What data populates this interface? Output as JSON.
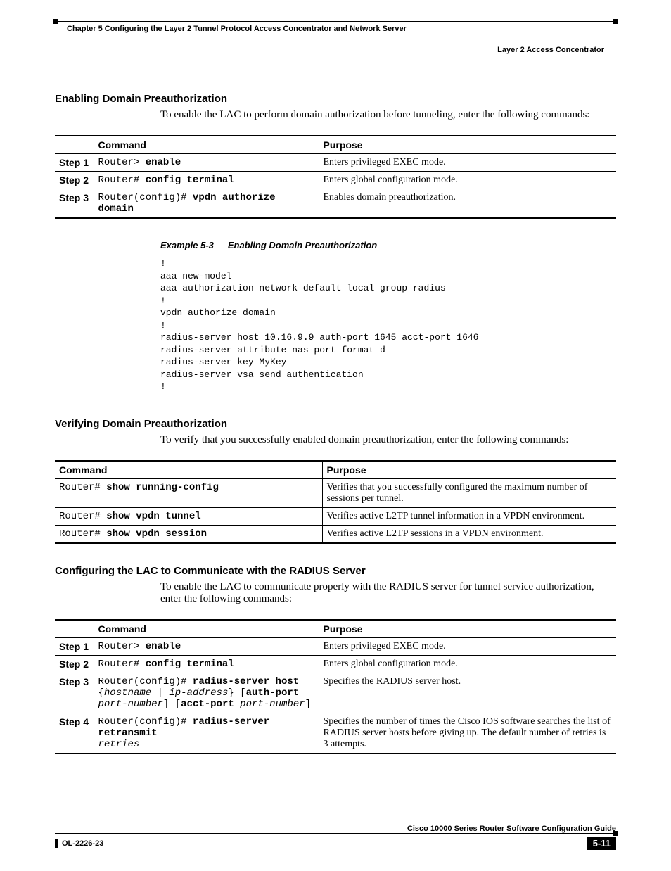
{
  "header": {
    "chapter": "Chapter 5    Configuring the Layer 2 Tunnel Protocol Access Concentrator and Network Server",
    "section": "Layer 2 Access Concentrator"
  },
  "s1": {
    "title": "Enabling Domain Preauthorization",
    "intro": "To enable the LAC to perform domain authorization before tunneling, enter the following commands:",
    "th_cmd": "Command",
    "th_purpose": "Purpose",
    "rows": [
      {
        "step": "Step 1",
        "prompt": "Router> ",
        "cmd": "enable",
        "purpose": "Enters privileged EXEC mode."
      },
      {
        "step": "Step 2",
        "prompt": "Router# ",
        "cmd": "config terminal",
        "purpose": "Enters global configuration mode."
      },
      {
        "step": "Step 3",
        "prompt": "Router(config)# ",
        "cmd": "vpdn authorize domain",
        "purpose": "Enables domain preauthorization."
      }
    ],
    "example_label": "Example 5-3",
    "example_title": "Enabling Domain Preauthorization",
    "code": "!\naaa new-model\naaa authorization network default local group radius\n!\nvpdn authorize domain\n!\nradius-server host 10.16.9.9 auth-port 1645 acct-port 1646\nradius-server attribute nas-port format d\nradius-server key MyKey\nradius-server vsa send authentication\n!"
  },
  "s2": {
    "title": "Verifying Domain Preauthorization",
    "intro": "To verify that you successfully enabled domain preauthorization, enter the following commands:",
    "th_cmd": "Command",
    "th_purpose": "Purpose",
    "rows": [
      {
        "prompt": "Router# ",
        "cmd": "show running-config",
        "purpose": "Verifies that you successfully configured the maximum number of sessions per tunnel."
      },
      {
        "prompt": "Router# ",
        "cmd": "show vpdn tunnel",
        "purpose": "Verifies active L2TP tunnel information in a VPDN environment."
      },
      {
        "prompt": "Router# ",
        "cmd": "show vpdn session",
        "purpose": "Verifies active L2TP sessions in a VPDN environment."
      }
    ]
  },
  "s3": {
    "title": "Configuring the LAC to Communicate with the RADIUS Server",
    "intro": "To enable the LAC to communicate properly with the RADIUS server for tunnel service authorization, enter the following commands:",
    "th_cmd": "Command",
    "th_purpose": "Purpose",
    "rows": [
      {
        "step": "Step 1",
        "purpose": "Enters privileged EXEC mode."
      },
      {
        "step": "Step 2",
        "purpose": "Enters global configuration mode."
      },
      {
        "step": "Step 3",
        "purpose": "Specifies the RADIUS server host."
      },
      {
        "step": "Step 4",
        "purpose": "Specifies the number of times the Cisco IOS software searches the list of RADIUS server hosts before giving up. The default number of retries is 3 attempts."
      }
    ],
    "r1_prompt": "Router> ",
    "r1_cmd": "enable",
    "r2_prompt": "Router# ",
    "r2_cmd": "config terminal",
    "r3_prompt": "Router(config)# ",
    "r3_cmd": "radius-server host",
    "r3_l2a": "{",
    "r3_l2b": "hostname",
    "r3_l2c": " | ",
    "r3_l2d": "ip-address",
    "r3_l2e": "} [",
    "r3_l2f": "auth-port",
    "r3_l3a": "port-number",
    "r3_l3b": "] [",
    "r3_l3c": "acct-port",
    "r3_l3d": " ",
    "r3_l3e": "port-number",
    "r3_l3f": "]",
    "r4_prompt": "Router(config)# ",
    "r4_cmd": "radius-server retransmit",
    "r4_l2": "retries"
  },
  "footer": {
    "guide": "Cisco 10000 Series Router Software Configuration Guide",
    "docid": "OL-2226-23",
    "page": "5-11"
  }
}
